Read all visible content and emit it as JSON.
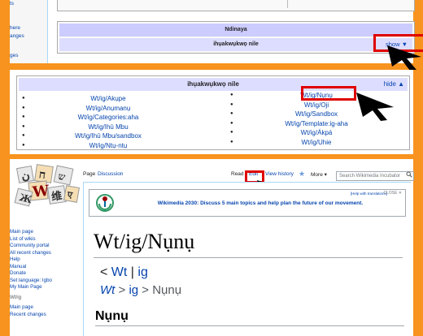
{
  "top_panel": {
    "sidebar_links": [
      "ts",
      "here",
      "anges",
      "ges"
    ],
    "navbox_title": "Ndinaya",
    "group_title": "ihụakwụkwọ nile",
    "show_label": "show ▼"
  },
  "middle_panel": {
    "group_title": "ihụakwụkwọ nile",
    "hide_label": "hide ▲",
    "left_items": [
      "Wt/ig/Akụpe",
      "Wt/ig/Anụmanụ",
      "Wt/ig/Categories:aha",
      "Wt/ig/Ihū Mbu",
      "Wt/ig/Ihū Mbu/sandbox",
      "Wt/ig/Ntụ-ntụ"
    ],
    "right_items": [
      "Wt/ig/Nụnụ",
      "Wt/ig/Oji",
      "Wt/ig/Sandbox",
      "Wt/ig/Template:ig-aha",
      "Wt/ig/Ákpá",
      "Wt/ig/Uhie"
    ]
  },
  "bottom_panel": {
    "tabs": {
      "page": "Page",
      "discussion": "Discussion",
      "read": "Read",
      "edit": "Edit",
      "view_history": "View history",
      "more": "More ▾"
    },
    "search_placeholder": "Search Wikimedia Incubator",
    "sidebar": [
      "Main page",
      "List of wikis",
      "Community portal",
      "All recent changes",
      "Help",
      "Manual",
      "Donate",
      "Set language: Igbo",
      "My Main Page"
    ],
    "sidebar_section": "Wt/ig",
    "sidebar2": [
      "Main page",
      "Recent changes"
    ],
    "notice_help": "[Help with translations]",
    "notice_close": "CLOSE ✕",
    "notice_text": "Wikimedia 2030: Discuss 5 main topics and help plan the future of our movement.",
    "page_title": "Wt/ig/Nụnụ",
    "breadcrumb1_prefix": "< ",
    "breadcrumb1_a": "Wt",
    "breadcrumb1_sep": " | ",
    "breadcrumb1_b": "ig",
    "breadcrumb2_a": "Wt",
    "breadcrumb2_sep": " > ",
    "breadcrumb2_b": "ig",
    "breadcrumb2_rest": " > Nụnụ",
    "heading": "Nụnụ"
  },
  "colors": {
    "frame": "#f7931e",
    "highlight": "#e00000",
    "link": "#0645ad"
  }
}
